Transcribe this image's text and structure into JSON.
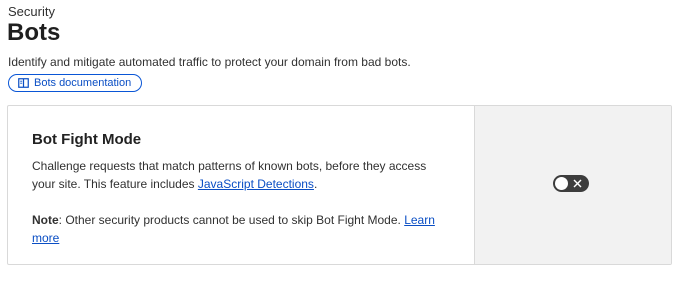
{
  "header": {
    "breadcrumb": "Security",
    "title": "Bots",
    "description": "Identify and mitigate automated traffic to protect your domain from bad bots."
  },
  "doc_button": {
    "label": "Bots documentation",
    "icon": "book-icon"
  },
  "card": {
    "title": "Bot Fight Mode",
    "desc_prefix": "Challenge requests that match patterns of known bots, before they access your site. This feature includes ",
    "desc_link": "JavaScript Detections",
    "desc_suffix": ".",
    "note_label": "Note",
    "note_text": ": Other security products cannot be used to skip Bot Fight Mode. ",
    "note_link": "Learn more",
    "toggle": {
      "state": "off",
      "icon": "close-icon"
    }
  },
  "colors": {
    "link": "#0a4ec4",
    "toggle_off": "#3d3d3d",
    "side_panel": "#f2f2f2",
    "border": "#d9d9d9"
  }
}
